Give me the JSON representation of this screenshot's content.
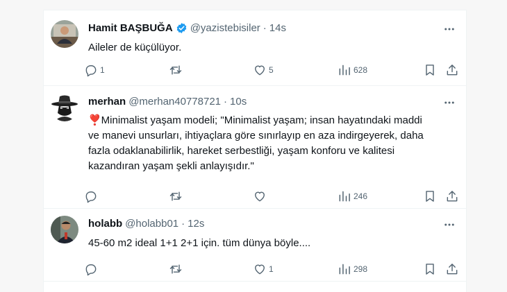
{
  "tweets": [
    {
      "name": "Hamit BAŞBUĞA",
      "handle": "@yazistebisiler",
      "separator": "·",
      "time": "14s",
      "verified": true,
      "text_lines": [
        "Aileler de küçülüyor."
      ],
      "replies": "1",
      "reposts": "",
      "likes": "5",
      "views": "628"
    },
    {
      "name": "merhan",
      "handle": "@merhan40778721",
      "separator": "·",
      "time": "10s",
      "verified": false,
      "text_lines": [
        "❣️Minimalist yaşam modeli; \"Minimalist yaşam; insan hayatındaki maddi",
        "ve manevi unsurları, ihtiyaçlara göre sınırlayıp en aza indirgeyerek, daha",
        "fazla odaklanabilirlik, hareket serbestliği,  yaşam konforu ve kalitesi",
        "kazandıran yaşam şekli anlayışıdır.\""
      ],
      "replies": "",
      "reposts": "",
      "likes": "",
      "views": "246"
    },
    {
      "name": "holabb",
      "handle": "@holabb01",
      "separator": "·",
      "time": "12s",
      "verified": false,
      "text_lines": [
        "45-60 m2 ideal 1+1  2+1 için. tüm dünya böyle...."
      ],
      "replies": "",
      "reposts": "",
      "likes": "1",
      "views": "298"
    }
  ],
  "icons": {
    "reply": "reply-icon",
    "repost": "repost-icon",
    "like": "like-icon",
    "views": "views-icon",
    "bookmark": "bookmark-icon",
    "share": "share-icon",
    "more": "more-icon",
    "verified": "verified-badge-icon"
  },
  "colors": {
    "text": "#0f1419",
    "secondary": "#536471",
    "verified": "#1d9bf0",
    "divider": "#eff3f4"
  }
}
